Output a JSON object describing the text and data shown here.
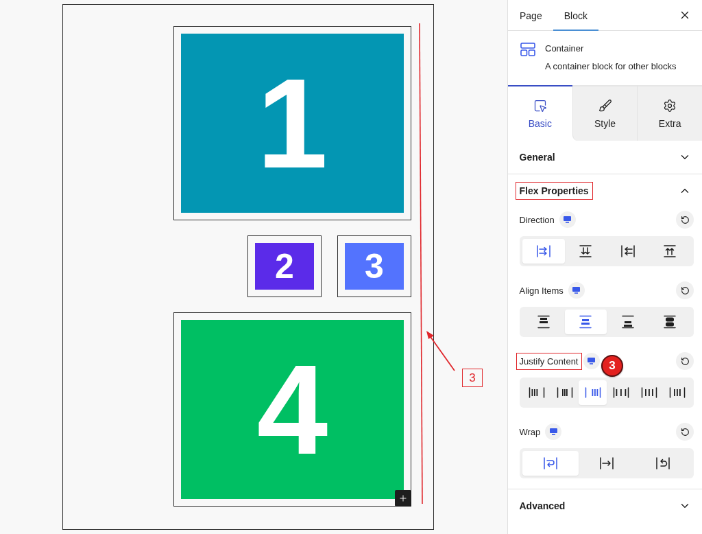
{
  "canvas": {
    "blocks": [
      {
        "label": "1",
        "kind": "large",
        "color": "#0396b3",
        "appender": false
      },
      {
        "label": "2",
        "kind": "small",
        "color": "#5b2be9",
        "appender": false
      },
      {
        "label": "3",
        "kind": "small",
        "color": "#5373fe",
        "appender": false
      },
      {
        "label": "4",
        "kind": "large",
        "color": "#00bf63",
        "appender": true
      }
    ],
    "annotation": {
      "label": "3"
    }
  },
  "sidebar": {
    "tabs": [
      {
        "label": "Page",
        "selected": false
      },
      {
        "label": "Block",
        "selected": true
      }
    ],
    "block_card": {
      "title": "Container",
      "description": "A container block for other blocks"
    },
    "inspector_tabs": [
      {
        "label": "Basic",
        "kind": "basic",
        "selected": true
      },
      {
        "label": "Style",
        "kind": "style",
        "selected": false
      },
      {
        "label": "Extra",
        "kind": "extra",
        "selected": false
      }
    ],
    "sections": [
      {
        "title": "General",
        "expanded": false,
        "highlighted": false
      },
      {
        "title": "Flex Properties",
        "expanded": true,
        "highlighted": true,
        "fields": [
          {
            "label": "Direction",
            "highlighted": false,
            "options": [
              {
                "kind": "row",
                "selected": true
              },
              {
                "kind": "column",
                "selected": false
              },
              {
                "kind": "row-reverse",
                "selected": false
              },
              {
                "kind": "column-reverse",
                "selected": false
              }
            ]
          },
          {
            "label": "Align Items",
            "highlighted": false,
            "options": [
              {
                "kind": "start",
                "selected": false
              },
              {
                "kind": "center",
                "selected": true
              },
              {
                "kind": "end",
                "selected": false
              },
              {
                "kind": "stretch",
                "selected": false
              }
            ]
          },
          {
            "label": "Justify Content",
            "highlighted": true,
            "callout": "3",
            "options": [
              {
                "kind": "start",
                "selected": false
              },
              {
                "kind": "center",
                "selected": false
              },
              {
                "kind": "end",
                "selected": true
              },
              {
                "kind": "space-between",
                "selected": false
              },
              {
                "kind": "space-around",
                "selected": false
              },
              {
                "kind": "space-evenly",
                "selected": false
              }
            ]
          },
          {
            "label": "Wrap",
            "highlighted": false,
            "options": [
              {
                "kind": "wrap",
                "selected": true
              },
              {
                "kind": "nowrap",
                "selected": false
              },
              {
                "kind": "wrap-reverse",
                "selected": false
              }
            ]
          }
        ]
      },
      {
        "title": "Advanced",
        "expanded": false,
        "highlighted": false
      }
    ]
  }
}
